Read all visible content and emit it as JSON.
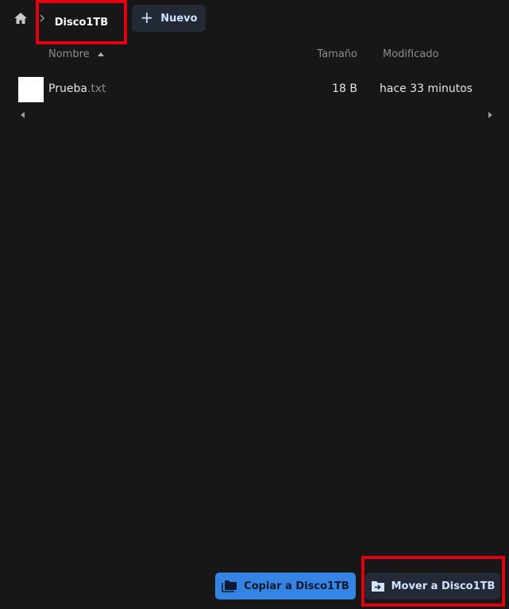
{
  "breadcrumb": {
    "current": "Disco1TB"
  },
  "toolbar": {
    "new_label": "Nuevo"
  },
  "columns": {
    "name": "Nombre",
    "size": "Tamaño",
    "modified": "Modificado"
  },
  "files": [
    {
      "name_base": "Prueba",
      "name_ext": ".txt",
      "size": "18 B",
      "modified": "hace 33 minutos"
    }
  ],
  "actions": {
    "copy_label": "Copiar a Disco1TB",
    "move_label": "Mover a Disco1TB"
  },
  "icons": {
    "home": "home-icon",
    "chevron": "chevron-right-icon",
    "plus": "plus-icon",
    "sort": "sort-ascending-icon",
    "copy": "folder-copy-icon",
    "move": "folder-move-icon"
  },
  "colors": {
    "background": "#171717",
    "accent": "#3584e4",
    "highlight_box": "#e1000f",
    "button_dark": "#232a35"
  }
}
